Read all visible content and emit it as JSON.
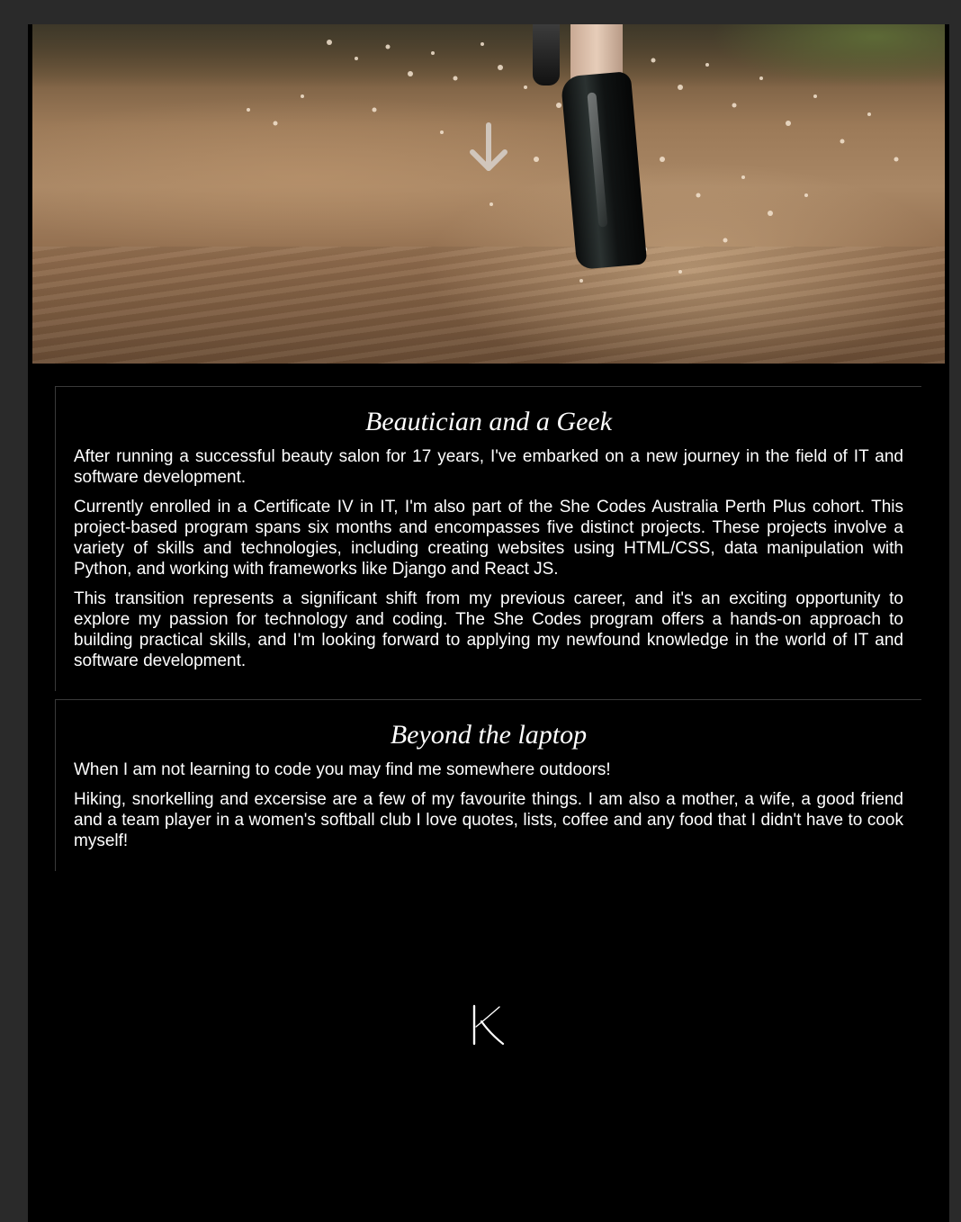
{
  "hero": {
    "image": "boot-splashing-through-muddy-water",
    "scroll_icon": "arrow-down-icon"
  },
  "sections": [
    {
      "title": "Beautician and a Geek",
      "paragraphs": [
        "After running a successful beauty salon for 17 years, I've embarked on a new journey in the field of IT and software development.",
        "Currently enrolled in a Certificate IV in IT, I'm also part of the She Codes Australia Perth Plus cohort. This project-based program spans six months and encompasses five distinct projects. These projects involve a variety of skills and technologies, including creating websites using HTML/CSS, data manipulation with Python, and working with frameworks like Django and React JS.",
        "This transition represents a significant shift from my previous career, and it's an exciting opportunity to explore my passion for technology and coding. The She Codes program offers a hands-on approach to building practical skills, and I'm looking forward to applying my newfound knowledge in the world of IT and software development."
      ]
    },
    {
      "title": "Beyond the laptop",
      "paragraphs": [
        "When I am not learning to code you may find me somewhere outdoors!",
        "Hiking, snorkelling and excersise are a few of my favourite things. I am also a mother, a wife, a good friend and a team player in a women's softball club I love quotes, lists, coffee and any food that I didn't have to cook myself!"
      ]
    }
  ],
  "footer": {
    "logo_icon": "k-monogram-logo"
  },
  "colors": {
    "page_background": "#000000",
    "outer_background": "#2a2a2a",
    "text": "#ffffff",
    "section_border": "#3a3a3a"
  }
}
